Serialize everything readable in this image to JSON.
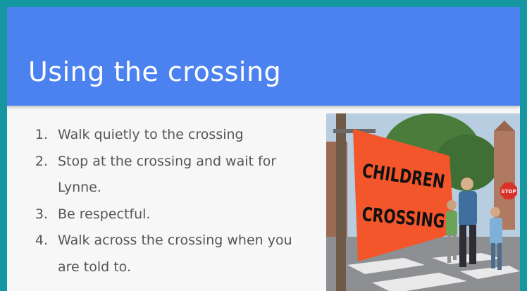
{
  "slide": {
    "title": "Using the crossing",
    "items": [
      {
        "num": "1.",
        "text": "Walk quietly to the crossing"
      },
      {
        "num": "2.",
        "text": "Stop at the crossing and wait for Lynne."
      },
      {
        "num": "3.",
        "text": "Be respectful."
      },
      {
        "num": "4.",
        "text": "Walk across the crossing when you are told to."
      }
    ],
    "photo": {
      "banner_line1": "CHILDREN",
      "banner_line2": "CROSSING",
      "stop_sign": "STOP"
    }
  },
  "colors": {
    "border": "#1497a0",
    "header": "#4c82ef",
    "body": "#f7f7f7",
    "text": "#555555",
    "banner": "#f2562a"
  }
}
